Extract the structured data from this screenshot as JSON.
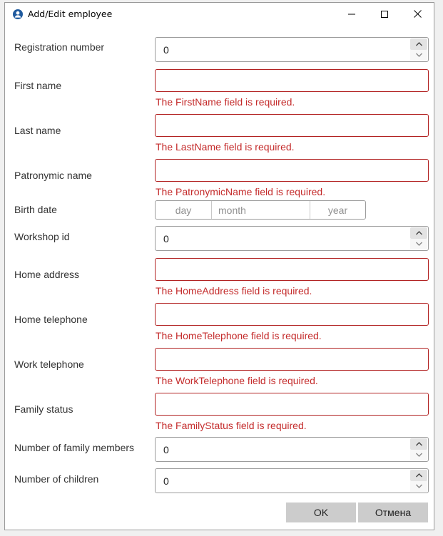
{
  "window": {
    "title": "Add/Edit employee",
    "icon": "user-circle-icon"
  },
  "form": {
    "registration_number": {
      "label": "Registration number",
      "value": "0"
    },
    "first_name": {
      "label": "First name",
      "value": "",
      "error": "The FirstName field is required."
    },
    "last_name": {
      "label": "Last name",
      "value": "",
      "error": "The LastName field is required."
    },
    "patronymic_name": {
      "label": "Patronymic name",
      "value": "",
      "error": "The PatronymicName field is required."
    },
    "birth_date": {
      "label": "Birth date",
      "day_placeholder": "day",
      "month_placeholder": "month",
      "year_placeholder": "year"
    },
    "workshop_id": {
      "label": "Workshop id",
      "value": "0"
    },
    "home_address": {
      "label": "Home address",
      "value": "",
      "error": "The HomeAddress field is required."
    },
    "home_telephone": {
      "label": "Home telephone",
      "value": "",
      "error": "The HomeTelephone field is required."
    },
    "work_telephone": {
      "label": "Work telephone",
      "value": "",
      "error": "The WorkTelephone field is required."
    },
    "family_status": {
      "label": "Family status",
      "value": "",
      "error": "The FamilyStatus field is required."
    },
    "family_members": {
      "label": "Number of family members",
      "value": "0"
    },
    "children": {
      "label": "Number of children",
      "value": "0"
    }
  },
  "buttons": {
    "ok": "OK",
    "cancel": "Отмена"
  },
  "colors": {
    "error": "#c42b2b",
    "error_border": "#b22222",
    "button_bg": "#cccccc"
  }
}
